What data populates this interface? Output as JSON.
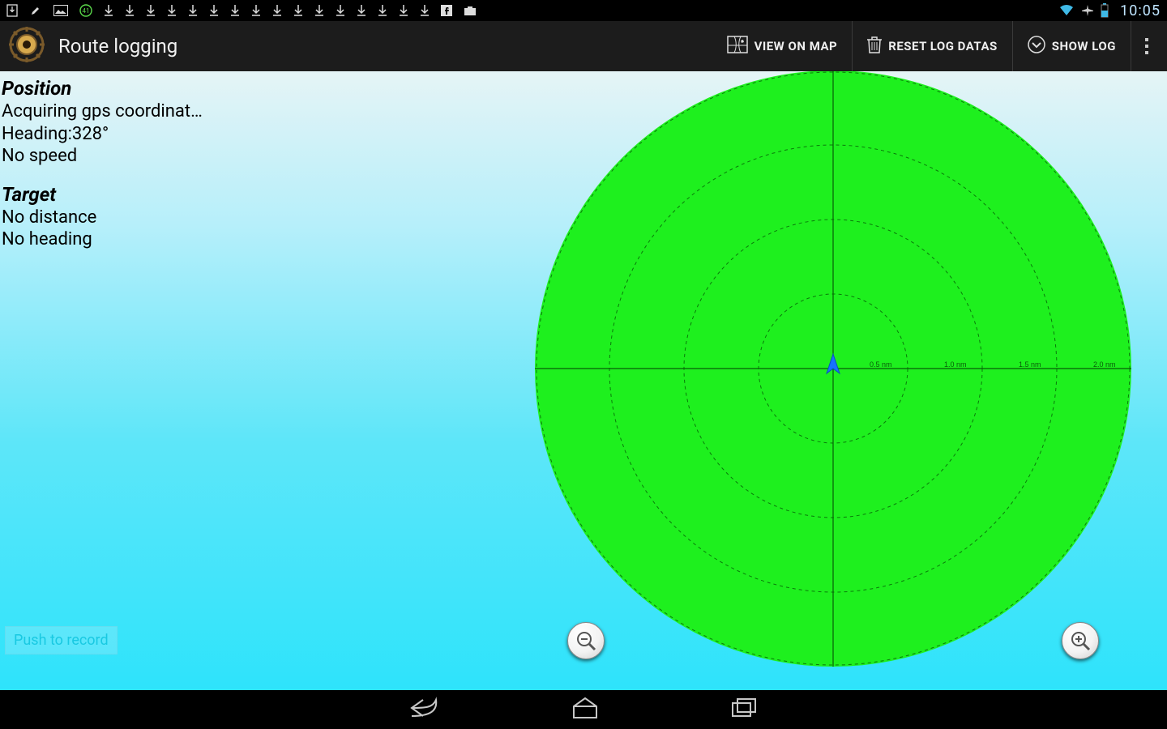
{
  "status": {
    "clock": "10:05",
    "notification_icons": [
      "download-box",
      "paint",
      "picture",
      "green-badge",
      "download",
      "download",
      "download",
      "download",
      "download",
      "download",
      "download",
      "download",
      "download",
      "download",
      "download",
      "download",
      "download",
      "download",
      "download",
      "download",
      "facebook",
      "briefcase"
    ],
    "right_icons": [
      "wifi",
      "airplane",
      "battery"
    ]
  },
  "appbar": {
    "title": "Route logging",
    "view_on_map": "VIEW ON MAP",
    "reset_log": "RESET LOG DATAS",
    "show_log": "SHOW LOG"
  },
  "info": {
    "position_label": "Position",
    "gps": "Acquiring gps coordinat…",
    "heading": "Heading:328°",
    "speed": "No speed",
    "target_label": "Target",
    "distance": "No distance",
    "target_heading": "No heading"
  },
  "radar": {
    "ring_labels": [
      "0.5 nm",
      "1.0 nm",
      "1.5 nm",
      "2.0 nm"
    ]
  },
  "buttons": {
    "record": "Push to record"
  },
  "chart_data": {
    "type": "radar",
    "title": "Route logging radar",
    "center_icon": "position-arrow",
    "heading_deg": 328,
    "rings_nm": [
      0.5,
      1.0,
      1.5,
      2.0
    ],
    "targets": []
  }
}
